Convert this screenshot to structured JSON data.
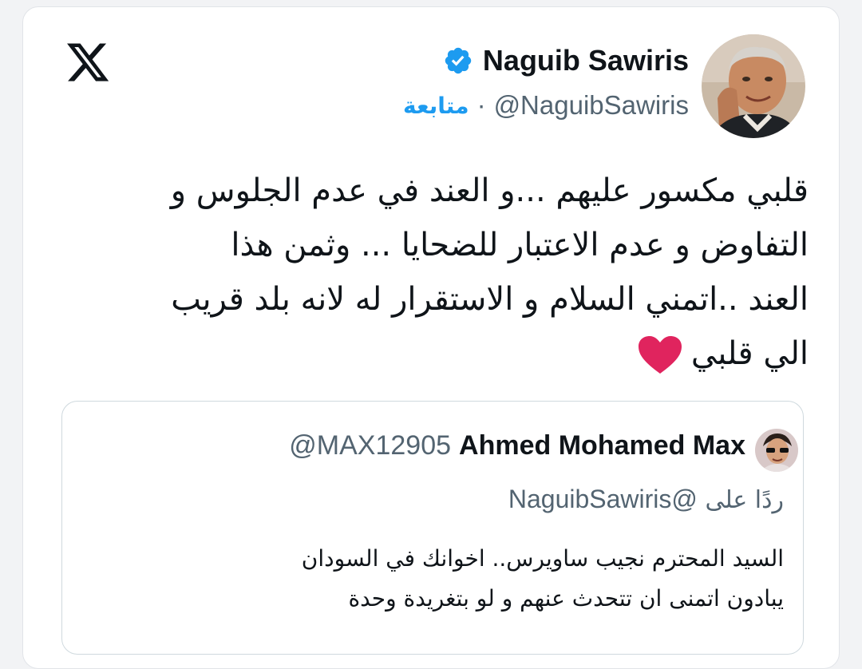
{
  "platform": {
    "logo_icon": "x-logo-icon"
  },
  "author": {
    "name": "Naguib Sawiris",
    "handle": "@NaguibSawiris",
    "separator": "·",
    "follow_label": "متابعة",
    "verified_icon": "verified-badge-icon",
    "verified_color": "#1d9bf0"
  },
  "tweet": {
    "lines": [
      "قلبي مكسور عليهم ...و العند في عدم الجلوس و",
      "التفاوض و عدم الاعتبار للضحايا ... وثمن هذا",
      "العند ..اتمني السلام و الاستقرار له لانه بلد قريب",
      "الي قلبي"
    ],
    "emoji_icon": "red-heart-icon"
  },
  "quoted_tweet": {
    "name": "Ahmed Mohamed Max",
    "handle": "@MAX12905",
    "reply_prefix": "ردًا على",
    "reply_handle": "@NaguibSawiris",
    "lines": [
      "السيد المحترم نجيب ساويرس.. اخوانك في السودان",
      "يبادون اتمنى ان تتحدث عنهم و لو بتغريدة وحدة"
    ]
  },
  "colors": {
    "accent": "#1d9bf0",
    "text": "#0f1419",
    "secondary_text": "#536471",
    "heart": "#e0245e"
  }
}
